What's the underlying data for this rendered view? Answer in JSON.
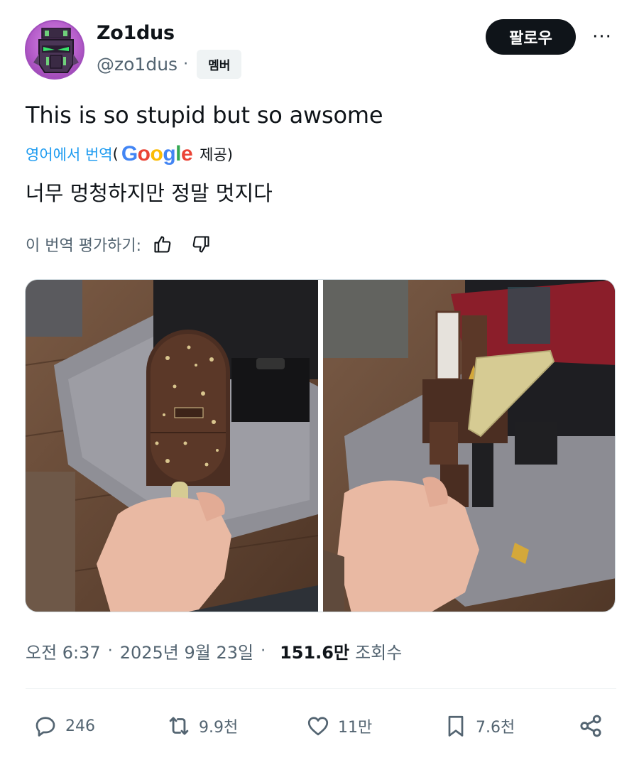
{
  "author": {
    "display_name": "Zo1dus",
    "handle": "@zo1dus",
    "badge": "멤버",
    "avatar_icon": "robot-helmet-avatar"
  },
  "header": {
    "follow_label": "팔로우",
    "more_icon": "more-horizontal-icon",
    "more_glyph": "···"
  },
  "tweet": {
    "text": "This is so stupid but so awsome",
    "translate_link": "영어에서 번역",
    "translate_open": "(",
    "translate_provider": "Google",
    "translate_provided": "제공)",
    "translated_text": "너무 멍청하지만 정말 멋지다",
    "rate_label": "이 번역 평가하기:"
  },
  "media": {
    "photos": [
      {
        "name": "photo-popsicle-toy",
        "icon": "image"
      },
      {
        "name": "photo-robot-transformed",
        "icon": "image"
      }
    ]
  },
  "meta": {
    "time": "오전 6:37",
    "sep": "·",
    "date": "2025년 9월 23일",
    "views_count": "151.6만",
    "views_label": "조회수"
  },
  "actions": {
    "replies": "246",
    "reposts": "9.9천",
    "likes": "11만",
    "bookmarks": "7.6천"
  },
  "colors": {
    "accent": "#1d9bf0",
    "text": "#0f1419",
    "muted": "#536471",
    "avatar": "#b45cc9"
  }
}
